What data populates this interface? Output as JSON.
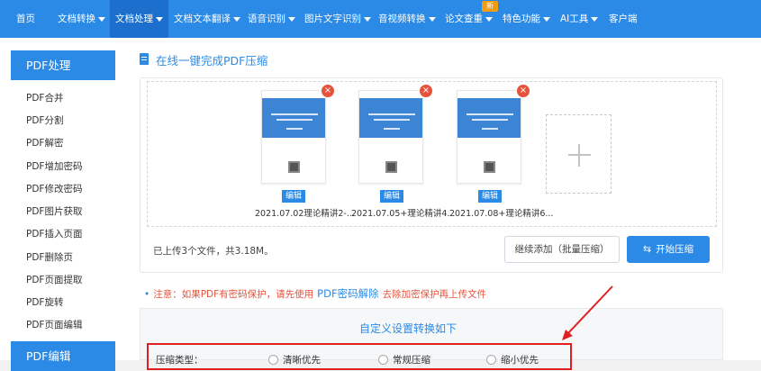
{
  "nav": {
    "items": [
      {
        "label": "首页",
        "dropdown": false
      },
      {
        "label": "文档转换",
        "dropdown": true
      },
      {
        "label": "文档处理",
        "dropdown": true
      },
      {
        "label": "文档文本翻译",
        "dropdown": true
      },
      {
        "label": "语音识别",
        "dropdown": true
      },
      {
        "label": "图片文字识别",
        "dropdown": true
      },
      {
        "label": "音视频转换",
        "dropdown": true
      },
      {
        "label": "论文查重",
        "dropdown": true
      },
      {
        "label": "特色功能",
        "dropdown": true
      },
      {
        "label": "AI工具",
        "dropdown": true
      },
      {
        "label": "客户端",
        "dropdown": false
      }
    ],
    "new_badge": "新",
    "active_label": "文档处理"
  },
  "sidebar": {
    "section_pdf": "PDF处理",
    "items": [
      "PDF合并",
      "PDF分割",
      "PDF解密",
      "PDF增加密码",
      "PDF修改密码",
      "PDF图片获取",
      "PDF插入页面",
      "PDF删除页",
      "PDF页面提取",
      "PDF旋转",
      "PDF页面编辑"
    ],
    "section_edit": "PDF编辑"
  },
  "main": {
    "title": "在线一键完成PDF压缩",
    "files": [
      {
        "name": "2021.07.02理论精讲2-...",
        "edit_label": "编辑"
      },
      {
        "name": "2021.07.05+理论精讲4...",
        "edit_label": "编辑"
      },
      {
        "name": "2021.07.08+理论精讲6...",
        "edit_label": "编辑"
      }
    ],
    "delete_symbol": "×",
    "add_symbol": "+",
    "summary": "已上传3个文件，共3.18M。",
    "batch_button": "继续添加（批量压缩）",
    "start_button": "开始压缩",
    "notice_prefix": "注意：如果PDF有密码保护，请先使用",
    "notice_link": "PDF密码解除",
    "notice_suffix": "去除加密保护再上传文件",
    "settings_title": "自定义设置转换如下",
    "compress_label": "压缩类型：",
    "compress_options": [
      "清晰优先",
      "常规压缩",
      "缩小优先"
    ]
  },
  "colors": {
    "brand_blue": "#2a8ae6",
    "warning_red": "#e5533c",
    "annotation_red": "#e02020",
    "badge_orange": "#f39c12"
  }
}
